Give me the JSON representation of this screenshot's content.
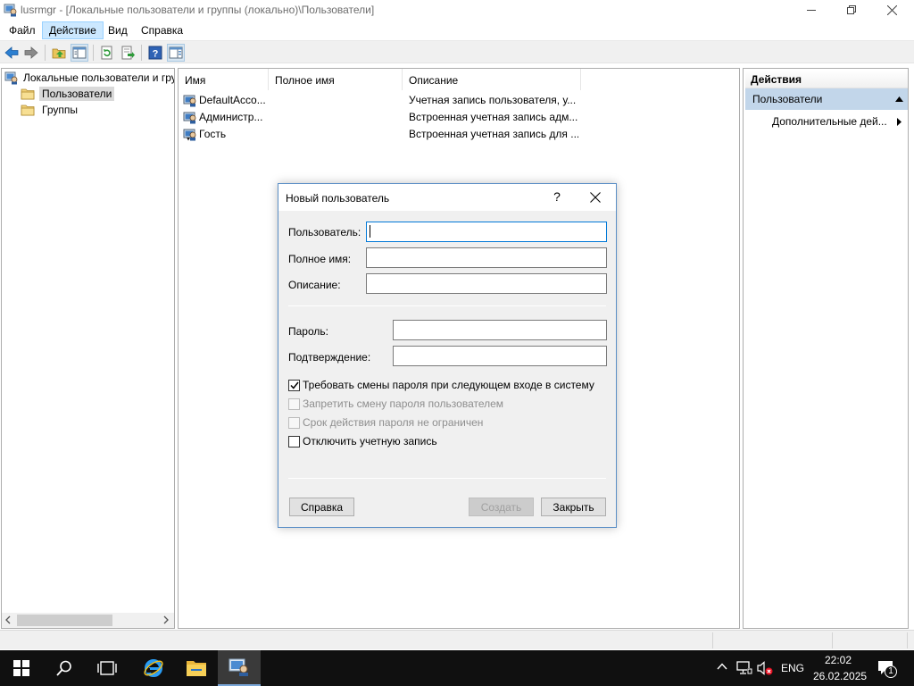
{
  "window": {
    "title": "lusrmgr - [Локальные пользователи и группы (локально)\\Пользователи]"
  },
  "menu": {
    "items": [
      "Файл",
      "Действие",
      "Вид",
      "Справка"
    ],
    "active_index": 1
  },
  "toolbar": {
    "icons": [
      "back-arrow-icon",
      "forward-arrow-icon",
      "up-folder-icon",
      "show-hide-tree-icon",
      "refresh-icon",
      "export-list-icon",
      "help-icon",
      "show-hide-action-pane-icon"
    ]
  },
  "tree": {
    "root": "Локальные пользователи и группы (локально)",
    "children": [
      "Пользователи",
      "Группы"
    ],
    "selected": "Пользователи"
  },
  "list": {
    "columns": [
      "Имя",
      "Полное имя",
      "Описание"
    ],
    "rows": [
      {
        "name": "DefaultAcco...",
        "full_name": "",
        "description": "Учетная запись пользователя, у..."
      },
      {
        "name": "Администр...",
        "full_name": "",
        "description": "Встроенная учетная запись адм..."
      },
      {
        "name": "Гость",
        "full_name": "",
        "description": "Встроенная учетная запись для ..."
      }
    ]
  },
  "actions": {
    "header": "Действия",
    "section": "Пользователи",
    "more": "Дополнительные дей..."
  },
  "dialog": {
    "title": "Новый пользователь",
    "help_glyph": "?",
    "fields": {
      "username_label": "Пользователь:",
      "username_value": "",
      "fullname_label": "Полное имя:",
      "fullname_value": "",
      "description_label": "Описание:",
      "description_value": "",
      "password_label": "Пароль:",
      "password_value": "",
      "confirm_label": "Подтверждение:",
      "confirm_value": ""
    },
    "checkboxes": [
      {
        "label": "Требовать смены пароля при следующем входе в систему",
        "checked": true,
        "enabled": true
      },
      {
        "label": "Запретить смену пароля пользователем",
        "checked": false,
        "enabled": false
      },
      {
        "label": "Срок действия пароля не ограничен",
        "checked": false,
        "enabled": false
      },
      {
        "label": "Отключить учетную запись",
        "checked": false,
        "enabled": true
      }
    ],
    "buttons": {
      "help": "Справка",
      "create": "Создать",
      "close": "Закрыть"
    }
  },
  "taskbar": {
    "language": "ENG",
    "time": "22:02",
    "date": "26.02.2025",
    "notification_count": "1"
  },
  "colors": {
    "selection_blue": "#c2d6ea",
    "menu_active": "#cce8ff",
    "dialog_border": "#5b8fc6",
    "taskbar": "#101010",
    "focus_border": "#0078d7"
  }
}
